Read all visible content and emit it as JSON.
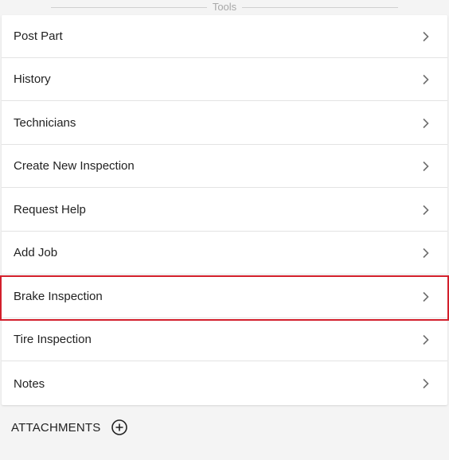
{
  "tools_section": {
    "title": "Tools",
    "items": [
      {
        "label": "Post Part"
      },
      {
        "label": "History"
      },
      {
        "label": "Technicians"
      },
      {
        "label": "Create New Inspection"
      },
      {
        "label": "Request Help"
      },
      {
        "label": "Add Job"
      },
      {
        "label": "Brake Inspection",
        "highlighted": true
      },
      {
        "label": "Tire Inspection"
      },
      {
        "label": "Notes"
      }
    ],
    "item_icon": "chevron-right-icon"
  },
  "attachments": {
    "label": "ATTACHMENTS",
    "add_icon": "add-circle-icon"
  },
  "colors": {
    "background": "#f4f4f4",
    "card": "#ffffff",
    "highlight": "#d21f2b",
    "divider_text": "#a8a8a8",
    "text": "#222222"
  }
}
